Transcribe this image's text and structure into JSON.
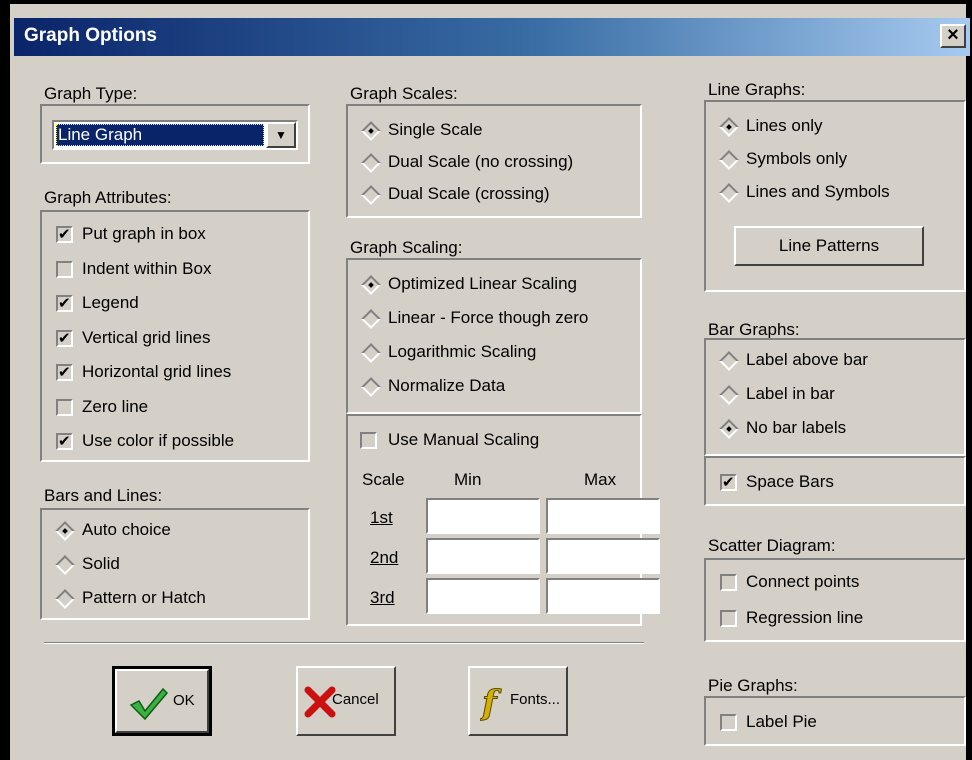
{
  "window": {
    "title": "Graph Options",
    "close": "×"
  },
  "graph_type": {
    "label": "Graph Type:",
    "selected": "Line Graph"
  },
  "graph_attributes": {
    "label": "Graph Attributes:",
    "items": [
      {
        "label": "Put graph in box",
        "checked": true
      },
      {
        "label": "Indent within Box",
        "checked": false
      },
      {
        "label": "Legend",
        "checked": true
      },
      {
        "label": "Vertical grid lines",
        "checked": true
      },
      {
        "label": "Horizontal grid lines",
        "checked": true
      },
      {
        "label": "Zero line",
        "checked": false
      },
      {
        "label": "Use color if possible",
        "checked": true
      }
    ]
  },
  "bars_and_lines": {
    "label": "Bars and Lines:",
    "items": [
      {
        "label": "Auto choice",
        "selected": true
      },
      {
        "label": "Solid",
        "selected": false
      },
      {
        "label": "Pattern or Hatch",
        "selected": false
      }
    ]
  },
  "graph_scales": {
    "label": "Graph Scales:",
    "items": [
      {
        "label": "Single Scale",
        "selected": true
      },
      {
        "label": "Dual Scale (no crossing)",
        "selected": false
      },
      {
        "label": "Dual Scale (crossing)",
        "selected": false
      }
    ]
  },
  "graph_scaling": {
    "label": "Graph Scaling:",
    "items": [
      {
        "label": "Optimized Linear Scaling",
        "selected": true
      },
      {
        "label": "Linear - Force though zero",
        "selected": false
      },
      {
        "label": "Logarithmic Scaling",
        "selected": false
      },
      {
        "label": "Normalize Data",
        "selected": false
      }
    ]
  },
  "manual_scaling": {
    "label": "Use Manual Scaling",
    "checked": false,
    "col_scale": "Scale",
    "col_min": "Min",
    "col_max": "Max",
    "rows": [
      {
        "label": "1st",
        "min": "",
        "max": ""
      },
      {
        "label": "2nd",
        "min": "",
        "max": ""
      },
      {
        "label": "3rd",
        "min": "",
        "max": ""
      }
    ]
  },
  "line_graphs": {
    "label": "Line Graphs:",
    "items": [
      {
        "label": "Lines only",
        "selected": true
      },
      {
        "label": "Symbols only",
        "selected": false
      },
      {
        "label": "Lines and Symbols",
        "selected": false
      }
    ],
    "patterns_button": "Line Patterns"
  },
  "bar_graphs": {
    "label": "Bar Graphs:",
    "items": [
      {
        "label": "Label above bar",
        "selected": false
      },
      {
        "label": "Label in bar",
        "selected": false
      },
      {
        "label": "No bar labels",
        "selected": true
      }
    ],
    "space_bars": {
      "label": "Space Bars",
      "checked": true
    }
  },
  "scatter": {
    "label": "Scatter Diagram:",
    "items": [
      {
        "label": "Connect points",
        "checked": false
      },
      {
        "label": "Regression line",
        "checked": false
      }
    ]
  },
  "pie": {
    "label": "Pie Graphs:",
    "item": {
      "label": "Label Pie",
      "checked": false
    }
  },
  "buttons": {
    "ok": "OK",
    "cancel": "Cancel",
    "fonts": "Fonts..."
  },
  "colors": {
    "title_start": "#0a246a",
    "title_end": "#a6caf0",
    "face": "#d4d0c8",
    "ok_check": "#3cb043",
    "cancel_x": "#cc1010",
    "fonts_f": "#d4b000"
  }
}
